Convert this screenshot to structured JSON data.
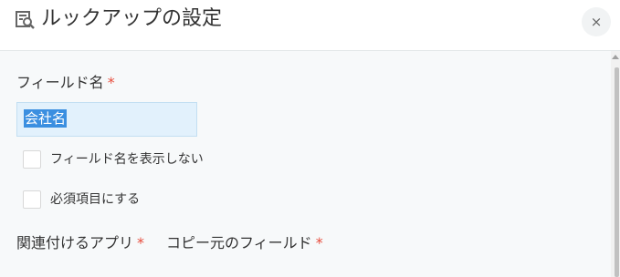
{
  "dialog": {
    "title": "ルックアップの設定",
    "close_label": "×"
  },
  "field_name": {
    "label": "フィールド名",
    "required_mark": "*",
    "value": "会社名"
  },
  "options": {
    "hide_field_name_label": "フィールド名を表示しない",
    "required_field_label": "必須項目にする"
  },
  "related_app": {
    "label": "関連付けるアプリ",
    "required_mark": "*"
  },
  "source_field": {
    "label": "コピー元のフィールド",
    "required_mark": "*"
  },
  "colors": {
    "required": "#e74c3c",
    "selection": "#3b8fe0",
    "input_bg": "#e2f1fc",
    "body_bg": "#f7f9fa"
  }
}
